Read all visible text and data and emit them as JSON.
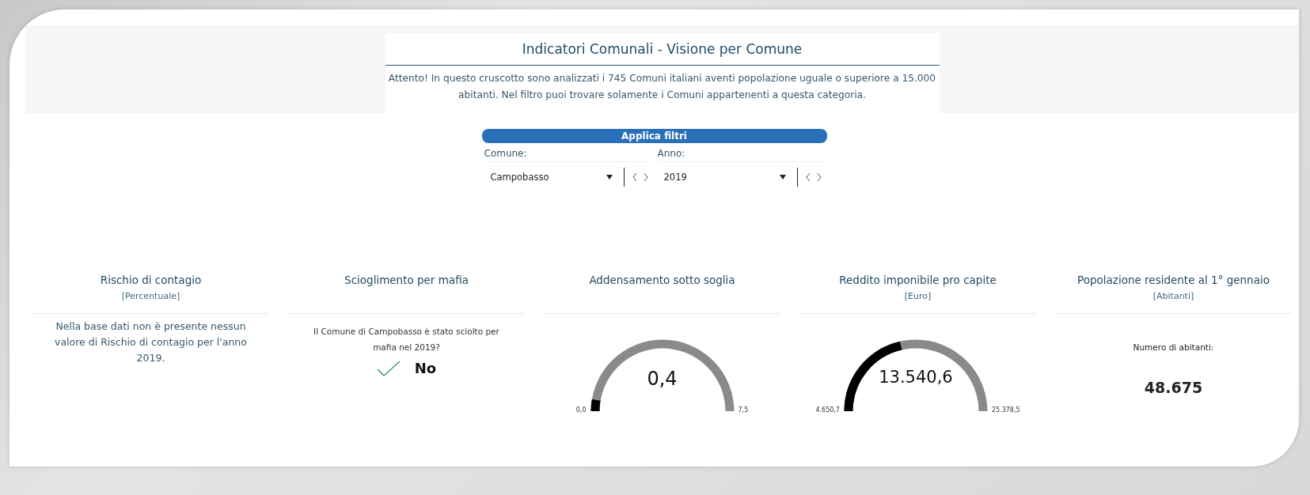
{
  "header": {
    "title": "Indicatori Comunali - Visione per Comune",
    "notice": "Attento! In questo cruscotto sono analizzati i 745 Comuni italiani aventi popolazione uguale o superiore a 15.000 abitanti. Nel filtro puoi trovare solamente i Comuni appartenenti a questa categoria."
  },
  "filters": {
    "apply_button": "Applica filtri",
    "fields": [
      {
        "label": "Comune:",
        "value": "Campobasso"
      },
      {
        "label": "Anno:",
        "value": "2019"
      }
    ]
  },
  "cards": [
    {
      "kind": "message",
      "title": "Rischio di contagio",
      "unit": "[Percentuale]",
      "text": "Nella base dati non è presente nessun valore di Rischio di contagio per l'anno 2019."
    },
    {
      "kind": "yesno",
      "title": "Scioglimento per mafia",
      "question": "Il Comune di Campobasso è stato sciolto per mafia nel 2019?",
      "answer": "No"
    },
    {
      "kind": "gauge",
      "title": "Addensamento sotto soglia",
      "value": "0,4",
      "min": "0,0",
      "max": "7,5"
    },
    {
      "kind": "gauge",
      "title": "Reddito imponibile pro capite",
      "unit": "[Euro]",
      "value": "13.540,6",
      "min": "4.650,7",
      "max": "25.378,5"
    },
    {
      "kind": "count",
      "title": "Popolazione residente al 1° gennaio",
      "unit": "[Abitanti]",
      "label": "Numero di abitanti:",
      "value": "48.675"
    }
  ]
}
